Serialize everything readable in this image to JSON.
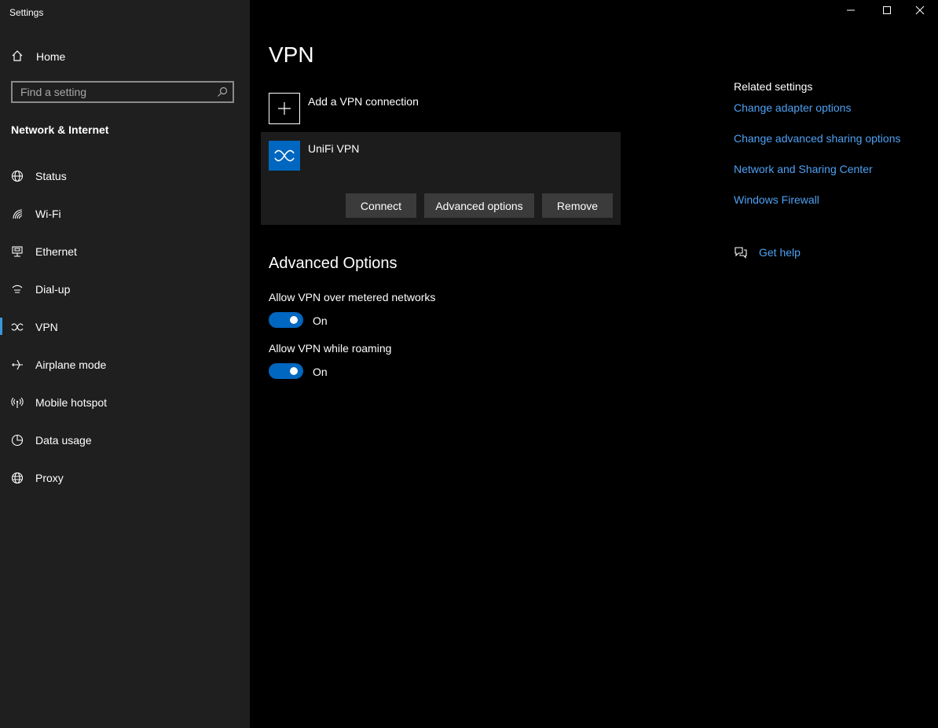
{
  "window": {
    "title": "Settings",
    "controls": [
      "minimize-icon",
      "maximize-icon",
      "close-icon"
    ]
  },
  "sidebar": {
    "home_label": "Home",
    "search_placeholder": "Find a setting",
    "section_title": "Network & Internet",
    "items": [
      {
        "label": "Status",
        "icon": "globe-status-icon"
      },
      {
        "label": "Wi-Fi",
        "icon": "wifi-icon"
      },
      {
        "label": "Ethernet",
        "icon": "ethernet-icon"
      },
      {
        "label": "Dial-up",
        "icon": "dialup-icon"
      },
      {
        "label": "VPN",
        "icon": "vpn-icon",
        "active": true
      },
      {
        "label": "Airplane mode",
        "icon": "airplane-icon"
      },
      {
        "label": "Mobile hotspot",
        "icon": "hotspot-icon"
      },
      {
        "label": "Data usage",
        "icon": "data-usage-icon"
      },
      {
        "label": "Proxy",
        "icon": "globe-icon"
      }
    ]
  },
  "main": {
    "title": "VPN",
    "add_vpn_label": "Add a VPN connection",
    "vpn_connection": {
      "name": "UniFi VPN",
      "buttons": {
        "connect": "Connect",
        "advanced": "Advanced options",
        "remove": "Remove"
      }
    },
    "advanced_title": "Advanced Options",
    "options": [
      {
        "label": "Allow VPN over metered networks",
        "state": "On"
      },
      {
        "label": "Allow VPN while roaming",
        "state": "On"
      }
    ]
  },
  "related": {
    "heading": "Related settings",
    "links": [
      "Change adapter options",
      "Change advanced sharing options",
      "Network and Sharing Center",
      "Windows Firewall"
    ],
    "help": "Get help"
  },
  "colors": {
    "accent": "#0067c0",
    "link": "#4ea1f3",
    "sidebar_bg": "#1f1f1f"
  }
}
